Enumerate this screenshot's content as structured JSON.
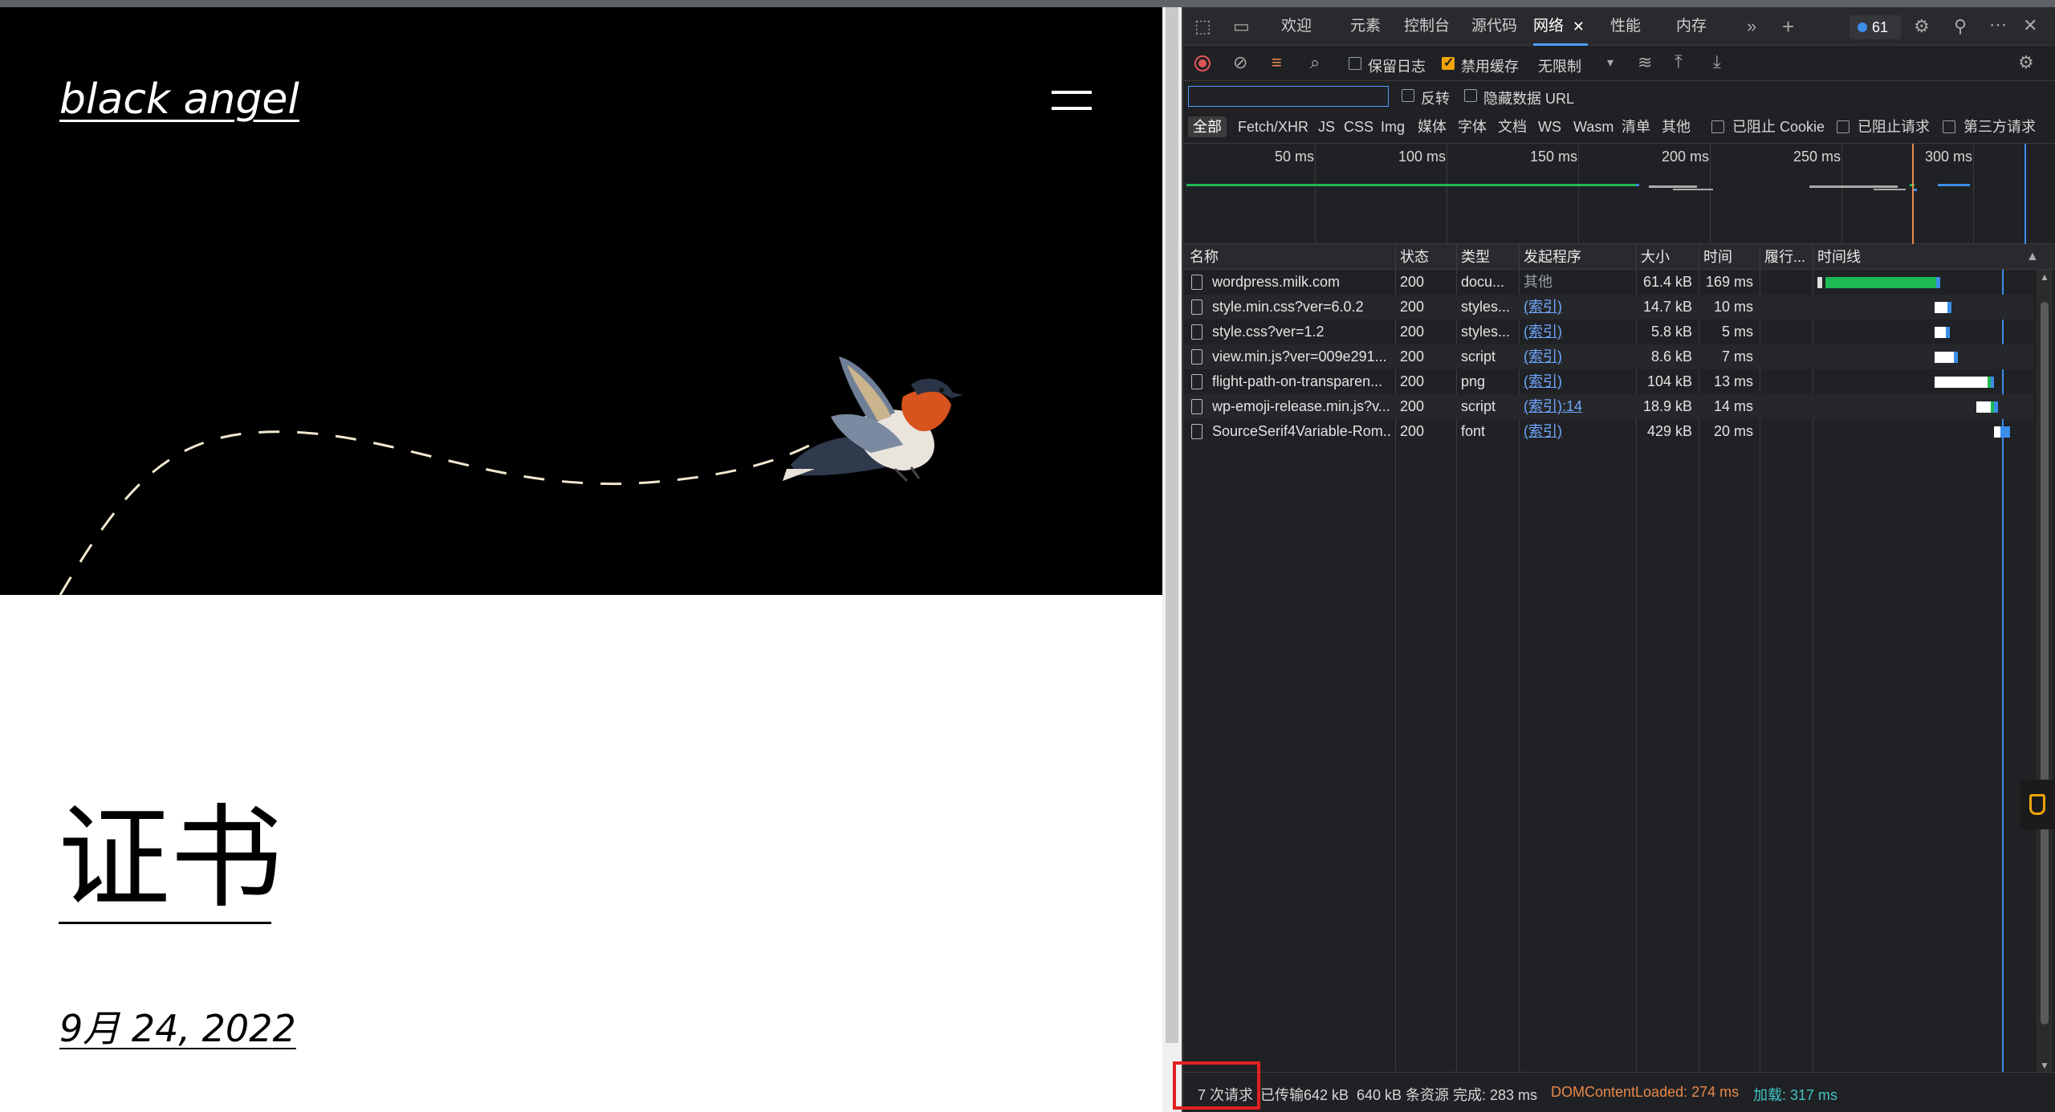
{
  "page": {
    "site_title": "black angel",
    "post_title": "证书",
    "post_date": "9月 24, 2022"
  },
  "devtools": {
    "tabs": [
      {
        "label": "欢迎"
      },
      {
        "label": "元素"
      },
      {
        "label": "控制台"
      },
      {
        "label": "源代码"
      },
      {
        "label": "网络",
        "active": true
      },
      {
        "label": "性能"
      },
      {
        "label": "内存"
      }
    ],
    "issue_count": "61",
    "toolbar": {
      "preserve_log": "保留日志",
      "disable_cache": "禁用缓存",
      "throttling": "无限制"
    },
    "filter": {
      "placeholder": "",
      "invert": "反转",
      "hide_data_urls": "隐藏数据 URL"
    },
    "type_filters": [
      "全部",
      "Fetch/XHR",
      "JS",
      "CSS",
      "Img",
      "媒体",
      "字体",
      "文档",
      "WS",
      "Wasm",
      "清单",
      "其他"
    ],
    "blocked_cookies": "已阻止 Cookie",
    "blocked_requests": "已阻止请求",
    "third_party": "第三方请求",
    "overview_ticks": [
      "50 ms",
      "100 ms",
      "150 ms",
      "200 ms",
      "250 ms",
      "300 ms"
    ],
    "columns": [
      "名称",
      "状态",
      "类型",
      "发起程序",
      "大小",
      "时间",
      "履行...",
      "时间线"
    ],
    "rows": [
      {
        "name": "wordpress.milk.com",
        "status": "200",
        "type": "docu...",
        "initiator": "其他",
        "size": "61.4 kB",
        "time": "169 ms"
      },
      {
        "name": "style.min.css?ver=6.0.2",
        "status": "200",
        "type": "styles...",
        "initiator": "(索引)",
        "size": "14.7 kB",
        "time": "10 ms"
      },
      {
        "name": "style.css?ver=1.2",
        "status": "200",
        "type": "styles...",
        "initiator": "(索引)",
        "size": "5.8 kB",
        "time": "5 ms"
      },
      {
        "name": "view.min.js?ver=009e291...",
        "status": "200",
        "type": "script",
        "initiator": "(索引)",
        "size": "8.6 kB",
        "time": "7 ms"
      },
      {
        "name": "flight-path-on-transparen...",
        "status": "200",
        "type": "png",
        "initiator": "(索引)",
        "size": "104 kB",
        "time": "13 ms"
      },
      {
        "name": "wp-emoji-release.min.js?v...",
        "status": "200",
        "type": "script",
        "initiator": "(索引):14",
        "size": "18.9 kB",
        "time": "14 ms"
      },
      {
        "name": "SourceSerif4Variable-Rom...",
        "status": "200",
        "type": "font",
        "initiator": "(索引)",
        "size": "429 kB",
        "time": "20 ms"
      }
    ],
    "status": {
      "requests": "7 次请求",
      "transferred": "已传输642 kB",
      "resources": "640 kB 条资源",
      "finish": "完成: 283 ms",
      "dom_content_loaded": "DOMContentLoaded: 274 ms",
      "load": "加载: 317 ms"
    },
    "colors": {
      "accent": "#4a9eff",
      "dcl": "#e8894a",
      "load": "#3fc4c4",
      "highlight": "#e02020"
    }
  }
}
